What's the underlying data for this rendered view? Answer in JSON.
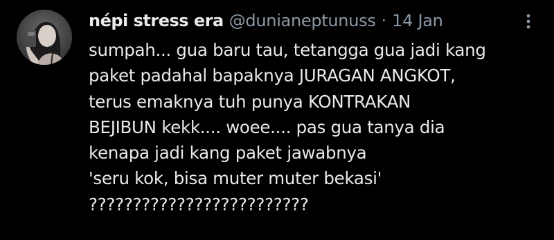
{
  "tweet": {
    "avatar_icon": "profile-photo-avatar",
    "display_name": "népi stress era",
    "handle": "@dunianeptunuss",
    "separator": "·",
    "date": "14 Jan",
    "more_icon": "more-options-vertical-icon",
    "text_lines": [
      "sumpah... gua baru tau, tetangga gua jadi kang",
      "paket padahal bapaknya JURAGAN ANGKOT,",
      "terus emaknya tuh punya KONTRAKAN",
      "BEJIBUN kekk.... woee.... pas gua tanya dia",
      "kenapa jadi kang paket jawabnya",
      "'seru kok, bisa muter muter bekasi'",
      "?????????????????????????"
    ]
  },
  "colors": {
    "background": "#000000",
    "primary_text": "#e7e9ea",
    "secondary_text": "#8b98a5"
  }
}
